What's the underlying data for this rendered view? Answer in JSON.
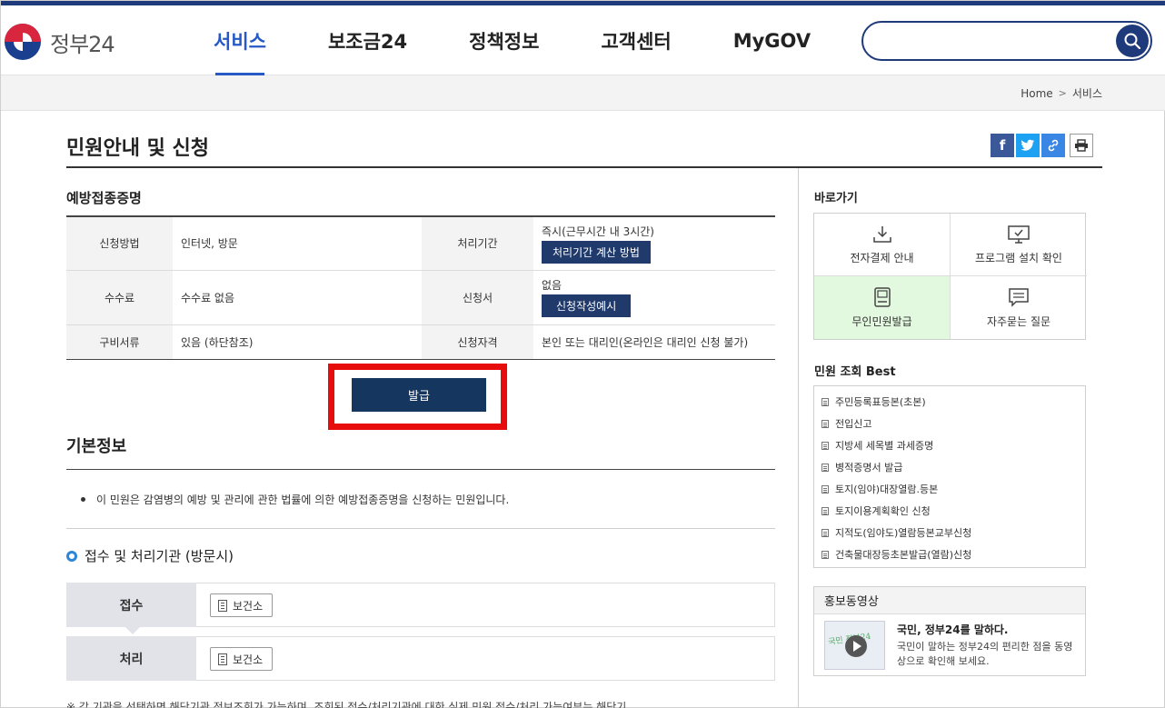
{
  "header": {
    "logo_text": "정부24",
    "nav": [
      "서비스",
      "보조금24",
      "정책정보",
      "고객센터",
      "MyGOV"
    ],
    "search_placeholder": ""
  },
  "breadcrumb": {
    "home": "Home",
    "current": "서비스"
  },
  "page": {
    "title": "민원안내 및 신청"
  },
  "service": {
    "name": "예방접종증명",
    "rows": [
      {
        "label": "신청방법",
        "value": "인터넷, 방문",
        "label2": "처리기간",
        "value2": "즉시(근무시간 내 3시간)",
        "button2": "처리기간 계산 방법"
      },
      {
        "label": "수수료",
        "value": "수수료 없음",
        "label2": "신청서",
        "value2": "없음",
        "button2": "신청작성예시"
      },
      {
        "label": "구비서류",
        "value": "있음 (하단참조)",
        "label2": "신청자격",
        "value2": "본인 또는 대리인(온라인은 대리인 신청 불가)"
      }
    ],
    "issue_button": "발급"
  },
  "basic_info": {
    "title": "기본정보",
    "description": "이 민원은 감염병의 예방 및 관리에 관한 법률에 의한 예방접종증명을 신청하는 민원입니다."
  },
  "process": {
    "title": "접수 및 처리기관 (방문시)",
    "receive_label": "접수",
    "receive_org": "보건소",
    "handle_label": "처리",
    "handle_org": "보건소",
    "footnote": "※ 각 기관을 선택하면 해당기관 정보조회가 가능하며, 조회된 접수/처리기관에 대한 실제 민원 접수/처리 가능여부는 해당기"
  },
  "sidebar": {
    "quick_title": "바로가기",
    "quick_links": [
      {
        "label": "전자결제 안내",
        "icon": "download-icon"
      },
      {
        "label": "프로그램 설치 확인",
        "icon": "monitor-icon"
      },
      {
        "label": "무인민원발급",
        "icon": "kiosk-icon"
      },
      {
        "label": "자주묻는 질문",
        "icon": "faq-icon"
      }
    ],
    "best_title": "민원 조회 Best",
    "best_items": [
      "주민등록표등본(초본)",
      "전입신고",
      "지방세 세목별 과세증명",
      "병적증명서 발급",
      "토지(임야)대장열람.등본",
      "토지이용계획확인 신청",
      "지적도(임야도)열람등본교부신청",
      "건축물대장등초본발급(열람)신청"
    ],
    "promo_title": "홍보동영상",
    "promo_video_title": "국민, 정부24를 말하다.",
    "promo_video_desc": "국민이 말하는 정부24의 편리한 점을 동영상으로 확인해 보세요."
  },
  "colors": {
    "brand_navy": "#1f3a7a",
    "accent_blue": "#2659c6",
    "highlight_red": "#e80d0d",
    "issue_button": "#14365f"
  }
}
